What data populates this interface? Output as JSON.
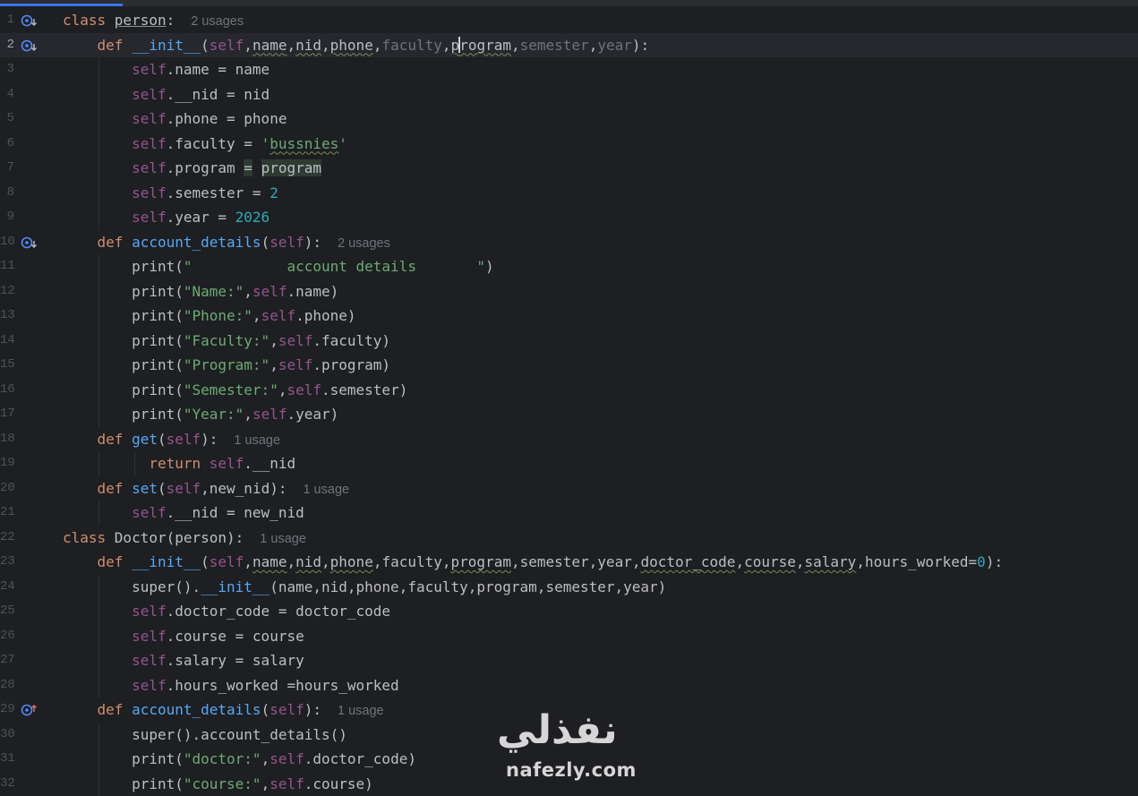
{
  "editor": {
    "lines": [
      {
        "n": "1",
        "current": false,
        "icon": "down",
        "tokens": [
          [
            "class ",
            "kw"
          ],
          [
            "person",
            "cls"
          ],
          [
            ":",
            ""
          ],
          [
            "2 usages",
            "hint"
          ]
        ]
      },
      {
        "n": "2",
        "current": true,
        "icon": "down",
        "tokens": [
          [
            "    ",
            ""
          ],
          [
            "def ",
            "kw"
          ],
          [
            "__init__",
            "fn"
          ],
          [
            "(",
            ""
          ],
          [
            "self",
            "sf"
          ],
          [
            ",",
            ""
          ],
          [
            "name",
            "und"
          ],
          [
            ",",
            ""
          ],
          [
            "nid",
            "und"
          ],
          [
            ",",
            ""
          ],
          [
            "phone",
            "und"
          ],
          [
            ",",
            ""
          ],
          [
            "faculty",
            "dim"
          ],
          [
            ",",
            ""
          ],
          [
            "p",
            "und"
          ],
          [
            "|",
            "caret"
          ],
          [
            "rogram",
            "und"
          ],
          [
            ",",
            ""
          ],
          [
            "semester",
            "dim"
          ],
          [
            ",",
            ""
          ],
          [
            "year",
            "dim"
          ],
          [
            "):",
            ""
          ]
        ]
      },
      {
        "n": "3",
        "current": false,
        "icon": "",
        "tokens": [
          [
            "        ",
            ""
          ],
          [
            "self",
            "sf"
          ],
          [
            ".name = name",
            ""
          ]
        ]
      },
      {
        "n": "4",
        "current": false,
        "icon": "",
        "tokens": [
          [
            "        ",
            ""
          ],
          [
            "self",
            "sf"
          ],
          [
            ".__nid = nid",
            ""
          ]
        ]
      },
      {
        "n": "5",
        "current": false,
        "icon": "",
        "tokens": [
          [
            "        ",
            ""
          ],
          [
            "self",
            "sf"
          ],
          [
            ".phone = phone",
            ""
          ]
        ]
      },
      {
        "n": "6",
        "current": false,
        "icon": "",
        "tokens": [
          [
            "        ",
            ""
          ],
          [
            "self",
            "sf"
          ],
          [
            ".faculty = ",
            ""
          ],
          [
            "'",
            "st"
          ],
          [
            "bussnies",
            "st und"
          ],
          [
            "'",
            "st"
          ]
        ]
      },
      {
        "n": "7",
        "current": false,
        "icon": "",
        "tokens": [
          [
            "        ",
            ""
          ],
          [
            "self",
            "sf"
          ],
          [
            ".program ",
            ""
          ],
          [
            "=",
            "hl"
          ],
          [
            " ",
            ""
          ],
          [
            "program",
            "hl"
          ]
        ]
      },
      {
        "n": "8",
        "current": false,
        "icon": "",
        "tokens": [
          [
            "        ",
            ""
          ],
          [
            "self",
            "sf"
          ],
          [
            ".semester = ",
            ""
          ],
          [
            "2",
            "nu"
          ]
        ]
      },
      {
        "n": "9",
        "current": false,
        "icon": "",
        "tokens": [
          [
            "        ",
            ""
          ],
          [
            "self",
            "sf"
          ],
          [
            ".year = ",
            ""
          ],
          [
            "2026",
            "nu"
          ]
        ]
      },
      {
        "n": "10",
        "current": false,
        "icon": "down",
        "tokens": [
          [
            "    ",
            ""
          ],
          [
            "def ",
            "kw"
          ],
          [
            "account_details",
            "fn"
          ],
          [
            "(",
            ""
          ],
          [
            "self",
            "sf"
          ],
          [
            "):",
            ""
          ],
          [
            "2 usages",
            "hint"
          ]
        ]
      },
      {
        "n": "11",
        "current": false,
        "icon": "",
        "tokens": [
          [
            "        ",
            ""
          ],
          [
            "print(",
            ""
          ],
          [
            "\"           account details       \"",
            "st"
          ],
          [
            ")",
            ""
          ]
        ]
      },
      {
        "n": "12",
        "current": false,
        "icon": "",
        "tokens": [
          [
            "        ",
            ""
          ],
          [
            "print(",
            ""
          ],
          [
            "\"Name:\"",
            "st"
          ],
          [
            ",",
            ""
          ],
          [
            "self",
            "sf"
          ],
          [
            ".name)",
            ""
          ]
        ]
      },
      {
        "n": "13",
        "current": false,
        "icon": "",
        "tokens": [
          [
            "        ",
            ""
          ],
          [
            "print(",
            ""
          ],
          [
            "\"Phone:\"",
            "st"
          ],
          [
            ",",
            ""
          ],
          [
            "self",
            "sf"
          ],
          [
            ".phone)",
            ""
          ]
        ]
      },
      {
        "n": "14",
        "current": false,
        "icon": "",
        "tokens": [
          [
            "        ",
            ""
          ],
          [
            "print(",
            ""
          ],
          [
            "\"Faculty:\"",
            "st"
          ],
          [
            ",",
            ""
          ],
          [
            "self",
            "sf"
          ],
          [
            ".faculty)",
            ""
          ]
        ]
      },
      {
        "n": "15",
        "current": false,
        "icon": "",
        "tokens": [
          [
            "        ",
            ""
          ],
          [
            "print(",
            ""
          ],
          [
            "\"Program:\"",
            "st"
          ],
          [
            ",",
            ""
          ],
          [
            "self",
            "sf"
          ],
          [
            ".program)",
            ""
          ]
        ]
      },
      {
        "n": "16",
        "current": false,
        "icon": "",
        "tokens": [
          [
            "        ",
            ""
          ],
          [
            "print(",
            ""
          ],
          [
            "\"Semester:\"",
            "st"
          ],
          [
            ",",
            ""
          ],
          [
            "self",
            "sf"
          ],
          [
            ".semester)",
            ""
          ]
        ]
      },
      {
        "n": "17",
        "current": false,
        "icon": "",
        "tokens": [
          [
            "        ",
            ""
          ],
          [
            "print(",
            ""
          ],
          [
            "\"Year:\"",
            "st"
          ],
          [
            ",",
            ""
          ],
          [
            "self",
            "sf"
          ],
          [
            ".year)",
            ""
          ]
        ]
      },
      {
        "n": "18",
        "current": false,
        "icon": "",
        "tokens": [
          [
            "    ",
            ""
          ],
          [
            "def ",
            "kw"
          ],
          [
            "get",
            "fn"
          ],
          [
            "(",
            ""
          ],
          [
            "self",
            "sf"
          ],
          [
            "):",
            ""
          ],
          [
            "1 usage",
            "hint"
          ]
        ]
      },
      {
        "n": "19",
        "current": false,
        "icon": "",
        "tokens": [
          [
            "          ",
            ""
          ],
          [
            "return ",
            "kw"
          ],
          [
            "self",
            "sf"
          ],
          [
            ".__nid",
            ""
          ]
        ]
      },
      {
        "n": "20",
        "current": false,
        "icon": "",
        "tokens": [
          [
            "    ",
            ""
          ],
          [
            "def ",
            "kw"
          ],
          [
            "set",
            "fn"
          ],
          [
            "(",
            ""
          ],
          [
            "self",
            "sf"
          ],
          [
            ",new_nid):",
            ""
          ],
          [
            "1 usage",
            "hint"
          ]
        ]
      },
      {
        "n": "21",
        "current": false,
        "icon": "",
        "tokens": [
          [
            "        ",
            ""
          ],
          [
            "self",
            "sf"
          ],
          [
            ".__nid = new_nid",
            ""
          ]
        ]
      },
      {
        "n": "22",
        "current": false,
        "icon": "",
        "tokens": [
          [
            "class ",
            "kw"
          ],
          [
            "Doctor(person):",
            ""
          ],
          [
            "1 usage",
            "hint"
          ]
        ]
      },
      {
        "n": "23",
        "current": false,
        "icon": "",
        "tokens": [
          [
            "    ",
            ""
          ],
          [
            "def ",
            "kw"
          ],
          [
            "__init__",
            "fn"
          ],
          [
            "(",
            ""
          ],
          [
            "self",
            "sf"
          ],
          [
            ",",
            ""
          ],
          [
            "name",
            "und"
          ],
          [
            ",",
            ""
          ],
          [
            "nid",
            "und"
          ],
          [
            ",",
            ""
          ],
          [
            "phone",
            "und"
          ],
          [
            ",faculty,",
            ""
          ],
          [
            "program",
            "und"
          ],
          [
            ",semester,year,",
            ""
          ],
          [
            "doctor_code",
            "und"
          ],
          [
            ",",
            ""
          ],
          [
            "course",
            "und"
          ],
          [
            ",",
            ""
          ],
          [
            "salary",
            "und"
          ],
          [
            ",hours_worked=",
            ""
          ],
          [
            "0",
            "nu"
          ],
          [
            "):",
            ""
          ]
        ]
      },
      {
        "n": "24",
        "current": false,
        "icon": "",
        "tokens": [
          [
            "        ",
            ""
          ],
          [
            "super().",
            ""
          ],
          [
            "__init__",
            "fn"
          ],
          [
            "(name,nid,phone,faculty,program,semester,year)",
            ""
          ]
        ]
      },
      {
        "n": "25",
        "current": false,
        "icon": "",
        "tokens": [
          [
            "        ",
            ""
          ],
          [
            "self",
            "sf"
          ],
          [
            ".doctor_code = doctor_code",
            ""
          ]
        ]
      },
      {
        "n": "26",
        "current": false,
        "icon": "",
        "tokens": [
          [
            "        ",
            ""
          ],
          [
            "self",
            "sf"
          ],
          [
            ".course = course",
            ""
          ]
        ]
      },
      {
        "n": "27",
        "current": false,
        "icon": "",
        "tokens": [
          [
            "        ",
            ""
          ],
          [
            "self",
            "sf"
          ],
          [
            ".salary = salary",
            ""
          ]
        ]
      },
      {
        "n": "28",
        "current": false,
        "icon": "",
        "tokens": [
          [
            "        ",
            ""
          ],
          [
            "self",
            "sf"
          ],
          [
            ".hours_worked =hours_worked",
            ""
          ]
        ]
      },
      {
        "n": "29",
        "current": false,
        "icon": "up",
        "tokens": [
          [
            "    ",
            ""
          ],
          [
            "def ",
            "kw"
          ],
          [
            "account_details",
            "fn"
          ],
          [
            "(",
            ""
          ],
          [
            "self",
            "sf"
          ],
          [
            "):",
            ""
          ],
          [
            "1 usage",
            "hint"
          ]
        ]
      },
      {
        "n": "30",
        "current": false,
        "icon": "",
        "tokens": [
          [
            "        ",
            ""
          ],
          [
            "super().account_details()",
            ""
          ]
        ]
      },
      {
        "n": "31",
        "current": false,
        "icon": "",
        "tokens": [
          [
            "        ",
            ""
          ],
          [
            "print(",
            ""
          ],
          [
            "\"doctor:\"",
            "st"
          ],
          [
            ",",
            ""
          ],
          [
            "self",
            "sf"
          ],
          [
            ".doctor_code)",
            ""
          ]
        ]
      },
      {
        "n": "32",
        "current": false,
        "icon": "",
        "tokens": [
          [
            "        ",
            ""
          ],
          [
            "print(",
            ""
          ],
          [
            "\"course:\"",
            "st"
          ],
          [
            ",",
            ""
          ],
          [
            "self",
            "sf"
          ],
          [
            ".course)",
            ""
          ]
        ]
      }
    ]
  },
  "watermark": {
    "arabic": "نفذلي",
    "latin": "nafezly.com"
  },
  "colors": {
    "background": "#1e1f22",
    "keyword": "#cf8e6d",
    "function": "#56a8f5",
    "self": "#94558d",
    "string": "#6aab73",
    "number": "#2aacb8",
    "hint": "#6f737a",
    "accent": "#3574f0"
  }
}
